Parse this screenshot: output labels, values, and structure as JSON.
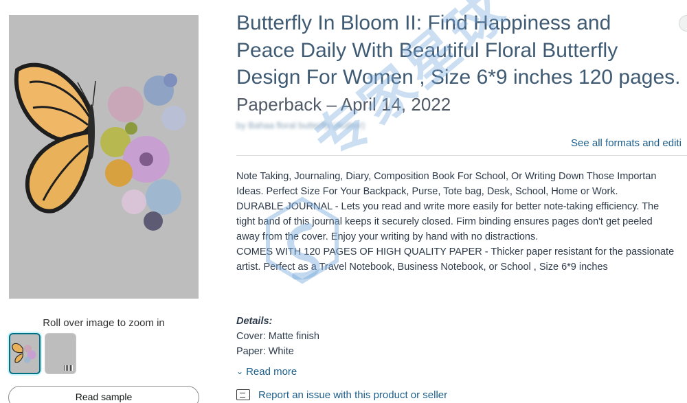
{
  "product": {
    "title_lines": [
      "Butterfly In Bloom II: Find Happiness and",
      "Peace Daily With Beautiful Floral Butterfly",
      "Design For Women , Size 6*9 inches 120 pages."
    ],
    "format_date": "Paperback – April 14, 2022",
    "author": "by Bahaa floral butterfly (Author)",
    "see_formats": "See all formats and editi"
  },
  "gallery": {
    "zoom_hint": "Roll over image to zoom in",
    "read_sample": "Read sample"
  },
  "description": [
    "Note Taking, Journaling, Diary, Composition Book For School, Or Writing Down Those Importan",
    "Ideas. Perfect Size For Your Backpack, Purse, Tote bag, Desk, School, Home or Work.",
    "DURABLE JOURNAL - Lets you read and write more easily for better note-taking efficiency. The",
    "tight band of this journal keeps it securely closed. Firm binding ensures pages don't get peeled",
    "away from the cover. Enjoy your writing by hand with no distractions.",
    "COMES WITH 120 PAGES OF HIGH QUALITY PAPER - Thicker paper resistant for the passionate",
    "artist. Perfect as a Travel Notebook, Business Notebook, or School , Size 6*9 inches"
  ],
  "details": {
    "heading": "Details:",
    "cover": "Cover: Matte finish",
    "paper": "Paper: White"
  },
  "links": {
    "read_more": "Read more",
    "report": "Report an issue with this product or seller"
  },
  "watermark": "专家星球",
  "colors": {
    "link": "#1a5e8c",
    "title": "#3f5a73",
    "selected_thumb": "#007185"
  }
}
